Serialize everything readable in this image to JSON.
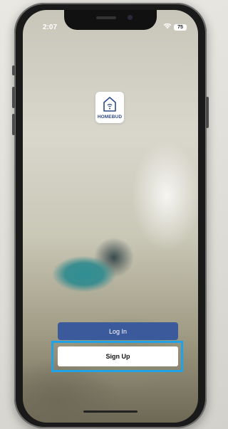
{
  "status_bar": {
    "time": "2:07",
    "wifi_icon": "wifi-icon",
    "battery": "75"
  },
  "app": {
    "logo_text": "HOMEBUD",
    "logo_icon": "house-wifi-icon",
    "brand_color": "#2f4a88"
  },
  "buttons": {
    "login_label": "Log In",
    "signup_label": "Sign Up",
    "login_color": "#3b5a9c",
    "highlight_color": "#1fa3e6"
  }
}
